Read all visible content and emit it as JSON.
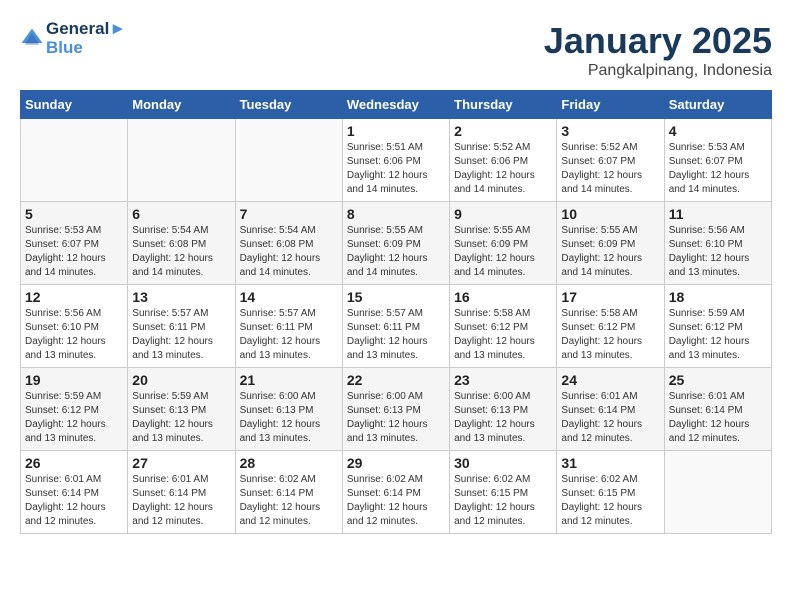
{
  "header": {
    "logo_line1": "General",
    "logo_line2": "Blue",
    "month": "January 2025",
    "location": "Pangkalpinang, Indonesia"
  },
  "weekdays": [
    "Sunday",
    "Monday",
    "Tuesday",
    "Wednesday",
    "Thursday",
    "Friday",
    "Saturday"
  ],
  "weeks": [
    [
      {
        "day": "",
        "info": ""
      },
      {
        "day": "",
        "info": ""
      },
      {
        "day": "",
        "info": ""
      },
      {
        "day": "1",
        "info": "Sunrise: 5:51 AM\nSunset: 6:06 PM\nDaylight: 12 hours\nand 14 minutes."
      },
      {
        "day": "2",
        "info": "Sunrise: 5:52 AM\nSunset: 6:06 PM\nDaylight: 12 hours\nand 14 minutes."
      },
      {
        "day": "3",
        "info": "Sunrise: 5:52 AM\nSunset: 6:07 PM\nDaylight: 12 hours\nand 14 minutes."
      },
      {
        "day": "4",
        "info": "Sunrise: 5:53 AM\nSunset: 6:07 PM\nDaylight: 12 hours\nand 14 minutes."
      }
    ],
    [
      {
        "day": "5",
        "info": "Sunrise: 5:53 AM\nSunset: 6:07 PM\nDaylight: 12 hours\nand 14 minutes."
      },
      {
        "day": "6",
        "info": "Sunrise: 5:54 AM\nSunset: 6:08 PM\nDaylight: 12 hours\nand 14 minutes."
      },
      {
        "day": "7",
        "info": "Sunrise: 5:54 AM\nSunset: 6:08 PM\nDaylight: 12 hours\nand 14 minutes."
      },
      {
        "day": "8",
        "info": "Sunrise: 5:55 AM\nSunset: 6:09 PM\nDaylight: 12 hours\nand 14 minutes."
      },
      {
        "day": "9",
        "info": "Sunrise: 5:55 AM\nSunset: 6:09 PM\nDaylight: 12 hours\nand 14 minutes."
      },
      {
        "day": "10",
        "info": "Sunrise: 5:55 AM\nSunset: 6:09 PM\nDaylight: 12 hours\nand 14 minutes."
      },
      {
        "day": "11",
        "info": "Sunrise: 5:56 AM\nSunset: 6:10 PM\nDaylight: 12 hours\nand 13 minutes."
      }
    ],
    [
      {
        "day": "12",
        "info": "Sunrise: 5:56 AM\nSunset: 6:10 PM\nDaylight: 12 hours\nand 13 minutes."
      },
      {
        "day": "13",
        "info": "Sunrise: 5:57 AM\nSunset: 6:11 PM\nDaylight: 12 hours\nand 13 minutes."
      },
      {
        "day": "14",
        "info": "Sunrise: 5:57 AM\nSunset: 6:11 PM\nDaylight: 12 hours\nand 13 minutes."
      },
      {
        "day": "15",
        "info": "Sunrise: 5:57 AM\nSunset: 6:11 PM\nDaylight: 12 hours\nand 13 minutes."
      },
      {
        "day": "16",
        "info": "Sunrise: 5:58 AM\nSunset: 6:12 PM\nDaylight: 12 hours\nand 13 minutes."
      },
      {
        "day": "17",
        "info": "Sunrise: 5:58 AM\nSunset: 6:12 PM\nDaylight: 12 hours\nand 13 minutes."
      },
      {
        "day": "18",
        "info": "Sunrise: 5:59 AM\nSunset: 6:12 PM\nDaylight: 12 hours\nand 13 minutes."
      }
    ],
    [
      {
        "day": "19",
        "info": "Sunrise: 5:59 AM\nSunset: 6:12 PM\nDaylight: 12 hours\nand 13 minutes."
      },
      {
        "day": "20",
        "info": "Sunrise: 5:59 AM\nSunset: 6:13 PM\nDaylight: 12 hours\nand 13 minutes."
      },
      {
        "day": "21",
        "info": "Sunrise: 6:00 AM\nSunset: 6:13 PM\nDaylight: 12 hours\nand 13 minutes."
      },
      {
        "day": "22",
        "info": "Sunrise: 6:00 AM\nSunset: 6:13 PM\nDaylight: 12 hours\nand 13 minutes."
      },
      {
        "day": "23",
        "info": "Sunrise: 6:00 AM\nSunset: 6:13 PM\nDaylight: 12 hours\nand 13 minutes."
      },
      {
        "day": "24",
        "info": "Sunrise: 6:01 AM\nSunset: 6:14 PM\nDaylight: 12 hours\nand 12 minutes."
      },
      {
        "day": "25",
        "info": "Sunrise: 6:01 AM\nSunset: 6:14 PM\nDaylight: 12 hours\nand 12 minutes."
      }
    ],
    [
      {
        "day": "26",
        "info": "Sunrise: 6:01 AM\nSunset: 6:14 PM\nDaylight: 12 hours\nand 12 minutes."
      },
      {
        "day": "27",
        "info": "Sunrise: 6:01 AM\nSunset: 6:14 PM\nDaylight: 12 hours\nand 12 minutes."
      },
      {
        "day": "28",
        "info": "Sunrise: 6:02 AM\nSunset: 6:14 PM\nDaylight: 12 hours\nand 12 minutes."
      },
      {
        "day": "29",
        "info": "Sunrise: 6:02 AM\nSunset: 6:14 PM\nDaylight: 12 hours\nand 12 minutes."
      },
      {
        "day": "30",
        "info": "Sunrise: 6:02 AM\nSunset: 6:15 PM\nDaylight: 12 hours\nand 12 minutes."
      },
      {
        "day": "31",
        "info": "Sunrise: 6:02 AM\nSunset: 6:15 PM\nDaylight: 12 hours\nand 12 minutes."
      },
      {
        "day": "",
        "info": ""
      }
    ]
  ]
}
